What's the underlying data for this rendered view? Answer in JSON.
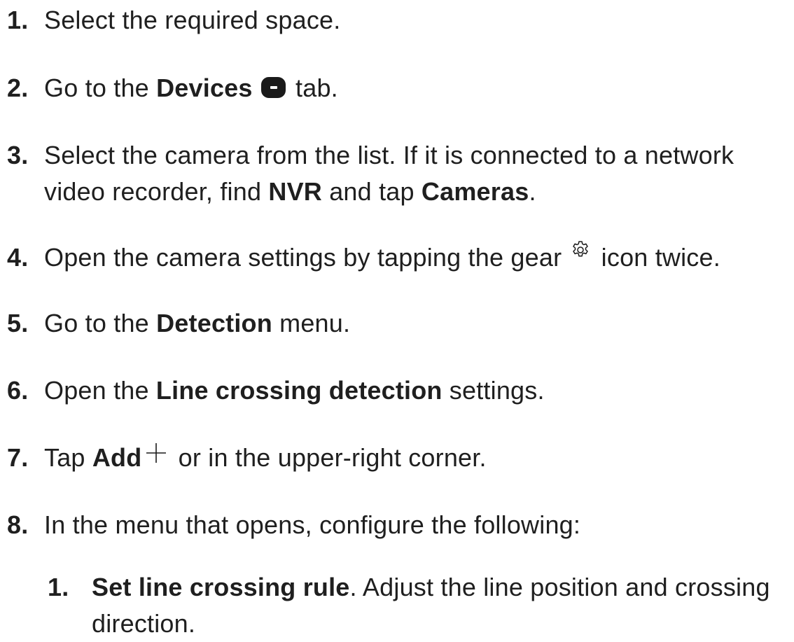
{
  "steps": [
    {
      "num": "1.",
      "text": "Select the required space."
    },
    {
      "num": "2.",
      "pre": "Go to the ",
      "bold": "Devices",
      "post": " tab.",
      "icon": "devices-icon"
    },
    {
      "num": "3.",
      "line1": "Select the camera from the list. If it is connected to a network",
      "line2_pre": "video recorder, find ",
      "line2_bold1": "NVR",
      "line2_mid": " and tap ",
      "line2_bold2": "Cameras",
      "line2_post": "."
    },
    {
      "num": "4.",
      "pre": "Open the camera settings by tapping the gear ",
      "post": " icon twice.",
      "icon": "gear-icon"
    },
    {
      "num": "5.",
      "pre": "Go to the ",
      "bold": "Detection",
      "post": " menu."
    },
    {
      "num": "6.",
      "pre": "Open the ",
      "bold": "Line crossing detection",
      "post": " settings."
    },
    {
      "num": "7.",
      "pre": "Tap ",
      "bold": "Add",
      "post": " or in the upper-right corner.",
      "icon": "plus-icon"
    },
    {
      "num": "8.",
      "text": "In the menu that opens, configure the following:"
    }
  ],
  "substeps": [
    {
      "num": "1.",
      "bold": "Set line crossing rule",
      "line1_post": ". Adjust the line position and crossing",
      "line2": "direction."
    }
  ]
}
